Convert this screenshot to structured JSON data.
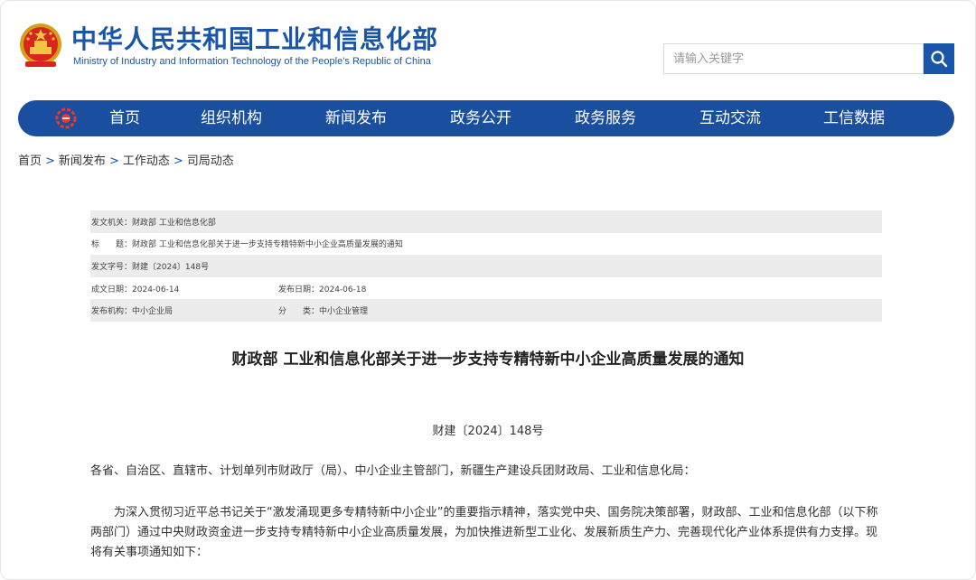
{
  "header": {
    "title": "中华人民共和国工业和信息化部",
    "subtitle": "Ministry of Industry and Information Technology of the People’s Republic of China",
    "search_placeholder": "请输入关键字"
  },
  "nav": {
    "items": [
      "首页",
      "组织机构",
      "新闻发布",
      "政务公开",
      "政务服务",
      "互动交流",
      "工信数据"
    ]
  },
  "breadcrumb": [
    "首页",
    "新闻发布",
    "工作动态",
    "司局动态"
  ],
  "meta": {
    "issuer_label": "发文机关：",
    "issuer": "财政部 工业和信息化部",
    "title_label": "标　　题：",
    "title": "财政部 工业和信息化部关于进一步支持专精特新中小企业高质量发展的通知",
    "doc_no_label": "发文字号：",
    "doc_no": "财建〔2024〕148号",
    "created_label": "成文日期：",
    "created": "2024-06-14",
    "published_label": "发布日期：",
    "published": "2024-06-18",
    "publisher_label": "发布机构：",
    "publisher": "中小企业局",
    "category_label": "分　　类：",
    "category": "中小企业管理"
  },
  "document": {
    "title": "财政部 工业和信息化部关于进一步支持专精特新中小企业高质量发展的通知",
    "number": "财建〔2024〕148号",
    "addressee": "各省、自治区、直辖市、计划单列市财政厅（局）、中小企业主管部门，新疆生产建设兵团财政局、工业和信息化局：",
    "paragraph1": "为深入贯彻习近平总书记关于“激发涌现更多专精特新中小企业”的重要指示精神，落实党中央、国务院决策部署，财政部、工业和信息化部（以下称两部门）通过中央财政资金进一步支持专精特新中小企业高质量发展，为加快推进新型工业化、发展新质生产力、完善现代化产业体系提供有力支撑。现将有关事项通知如下："
  },
  "colors": {
    "brand_blue": "#1a56a8",
    "nav_blue": "#1a4fa0",
    "row_shade": "#ececec"
  },
  "icons": {
    "emblem": "national-emblem-icon",
    "search": "search-icon",
    "nav_logo": "miit-logo-icon"
  }
}
